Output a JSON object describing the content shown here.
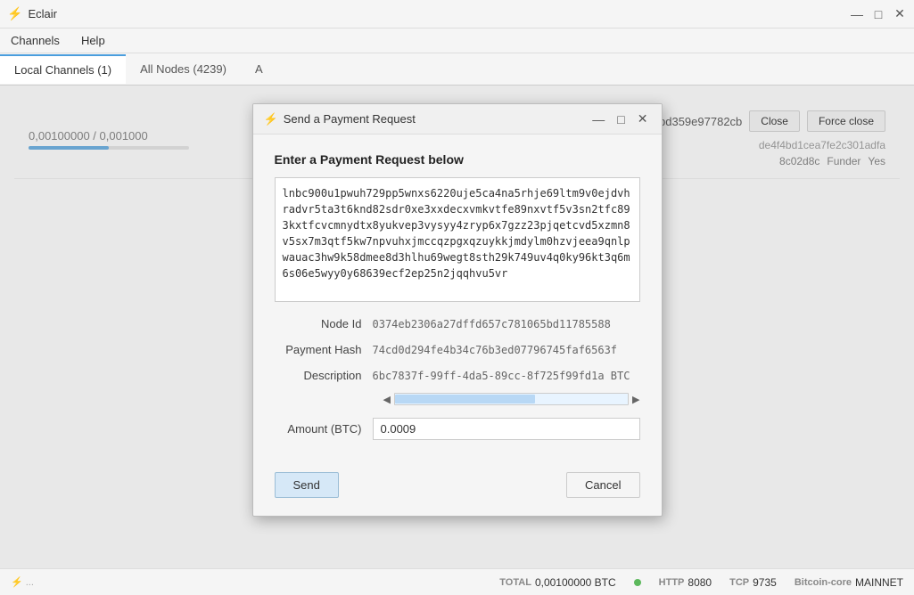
{
  "app": {
    "title": "Eclair",
    "title_icon": "⚡"
  },
  "title_controls": {
    "minimize": "—",
    "maximize": "□",
    "close": "✕"
  },
  "menu": {
    "channels": "Channels",
    "help": "Help"
  },
  "tabs": [
    {
      "label": "Local Channels (1)",
      "active": true
    },
    {
      "label": "All Nodes (4239)",
      "active": false
    },
    {
      "label": "A",
      "active": false
    }
  ],
  "channel": {
    "amount": "0,00100000 / 0,001000",
    "id": "bd359e97782cb",
    "close_label": "Close",
    "force_close_label": "Force close",
    "details": "de4f4bd1cea7fe2c301adfa",
    "extra": "8c02d8c",
    "funder_label": "Funder",
    "funder_value": "Yes"
  },
  "modal": {
    "title": "Send a Payment Request",
    "icon": "⚡",
    "heading": "Enter a Payment Request below",
    "payment_request": "lnbc900u1pwuh729pp5wnxs6220uje5ca4na5rhje69ltm9v0ejdvhradvr5ta3t6knd82sdr0xe3xxdecxvmkvtfe89nxvtf5v3sn2tfc893kxtfcvcmnydtx8yukvep3vysyy4zryp6x7gzz23pjqetcvd5xzmn8v5sx7m3qtf5kw7npvuhxjmccqzpgxqzuykkjmdylm0hzvjeea9qnlpwauac3hw9k58dmee8d3hlhu69wegt8sth29k749uv4q0ky96kt3q6m6s06e5wyy0y68639ecf2ep25n2jqqhvu5vr",
    "node_id_label": "Node Id",
    "node_id_value": "0374eb2306a27dffd657c781065bd11785588",
    "payment_hash_label": "Payment Hash",
    "payment_hash_value": "74cd0d294fe4b34c76b3ed07796745faf6563f",
    "description_label": "Description",
    "description_value": "6bc7837f-99ff-4da5-89cc-8f725f99fd1a BTC",
    "amount_label": "Amount (BTC)",
    "amount_value": "0.0009",
    "send_label": "Send",
    "cancel_label": "Cancel",
    "minimize": "—",
    "maximize": "□",
    "close": "✕"
  },
  "status_bar": {
    "left_text": "⚡ ...",
    "total_label": "TOTAL",
    "total_value": "0,00100000 BTC",
    "http_label": "HTTP",
    "http_value": "8080",
    "tcp_label": "TCP",
    "tcp_value": "9735",
    "node_label": "Bitcoin-core",
    "node_value": "MAINNET"
  }
}
